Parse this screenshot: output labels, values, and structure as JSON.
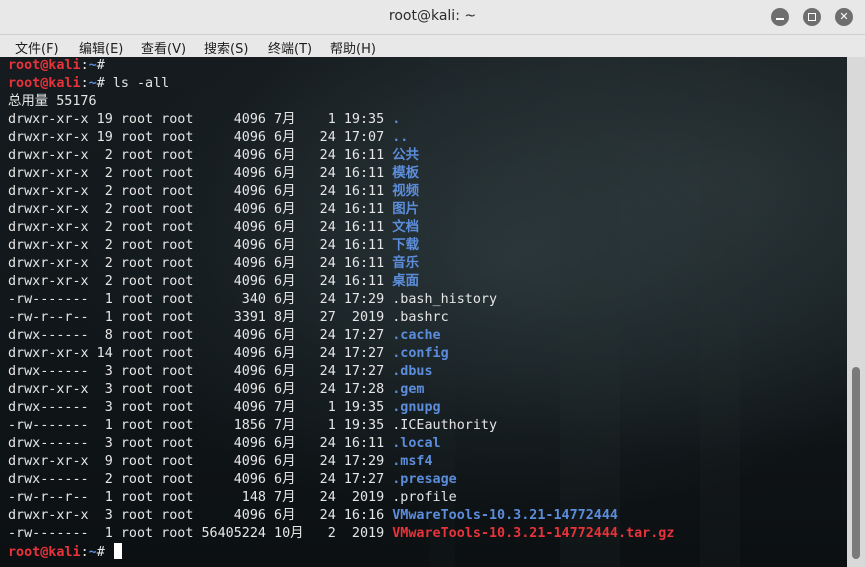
{
  "window": {
    "title": "root@kali: ~"
  },
  "menu": [
    "文件(F)",
    "编辑(E)",
    "查看(V)",
    "搜索(S)",
    "终端(T)",
    "帮助(H)"
  ],
  "prompt": {
    "user": "root@kali",
    "sep": ":",
    "path": "~",
    "symbol": "#"
  },
  "command": " ls -all",
  "total_line": "总用量 55176",
  "entries": [
    {
      "meta": "drwxr-xr-x 19 root root     4096 7月    1 19:35 ",
      "name": ".",
      "type": "dir"
    },
    {
      "meta": "drwxr-xr-x 19 root root     4096 6月   24 17:07 ",
      "name": "..",
      "type": "dir"
    },
    {
      "meta": "drwxr-xr-x  2 root root     4096 6月   24 16:11 ",
      "name": "公共",
      "type": "dir"
    },
    {
      "meta": "drwxr-xr-x  2 root root     4096 6月   24 16:11 ",
      "name": "模板",
      "type": "dir"
    },
    {
      "meta": "drwxr-xr-x  2 root root     4096 6月   24 16:11 ",
      "name": "视频",
      "type": "dir"
    },
    {
      "meta": "drwxr-xr-x  2 root root     4096 6月   24 16:11 ",
      "name": "图片",
      "type": "dir"
    },
    {
      "meta": "drwxr-xr-x  2 root root     4096 6月   24 16:11 ",
      "name": "文档",
      "type": "dir"
    },
    {
      "meta": "drwxr-xr-x  2 root root     4096 6月   24 16:11 ",
      "name": "下载",
      "type": "dir"
    },
    {
      "meta": "drwxr-xr-x  2 root root     4096 6月   24 16:11 ",
      "name": "音乐",
      "type": "dir"
    },
    {
      "meta": "drwxr-xr-x  2 root root     4096 6月   24 16:11 ",
      "name": "桌面",
      "type": "dir"
    },
    {
      "meta": "-rw-------  1 root root      340 6月   24 17:29 ",
      "name": ".bash_history",
      "type": "file"
    },
    {
      "meta": "-rw-r--r--  1 root root     3391 8月   27  2019 ",
      "name": ".bashrc",
      "type": "file"
    },
    {
      "meta": "drwx------  8 root root     4096 6月   24 17:27 ",
      "name": ".cache",
      "type": "dir"
    },
    {
      "meta": "drwxr-xr-x 14 root root     4096 6月   24 17:27 ",
      "name": ".config",
      "type": "dir"
    },
    {
      "meta": "drwx------  3 root root     4096 6月   24 17:27 ",
      "name": ".dbus",
      "type": "dir"
    },
    {
      "meta": "drwxr-xr-x  3 root root     4096 6月   24 17:28 ",
      "name": ".gem",
      "type": "dir"
    },
    {
      "meta": "drwx------  3 root root     4096 7月    1 19:35 ",
      "name": ".gnupg",
      "type": "dir"
    },
    {
      "meta": "-rw-------  1 root root     1856 7月    1 19:35 ",
      "name": ".ICEauthority",
      "type": "file"
    },
    {
      "meta": "drwx------  3 root root     4096 6月   24 16:11 ",
      "name": ".local",
      "type": "dir"
    },
    {
      "meta": "drwxr-xr-x  9 root root     4096 6月   24 17:29 ",
      "name": ".msf4",
      "type": "dir"
    },
    {
      "meta": "drwx------  2 root root     4096 6月   24 17:27 ",
      "name": ".presage",
      "type": "dir"
    },
    {
      "meta": "-rw-r--r--  1 root root      148 7月   24  2019 ",
      "name": ".profile",
      "type": "file"
    },
    {
      "meta": "drwxr-xr-x  3 root root     4096 6月   24 16:16 ",
      "name": "VMwareTools-10.3.21-14772444",
      "type": "dir"
    },
    {
      "meta": "-rw-------  1 root root 56405224 10月   2  2019 ",
      "name": "VMwareTools-10.3.21-14772444.tar.gz",
      "type": "archive"
    }
  ],
  "icons": {
    "minimize": "minimize-icon",
    "maximize": "maximize-icon",
    "close": "close-icon"
  },
  "colors": {
    "prompt_user": "#e8333a",
    "prompt_path": "#5c8ddb",
    "directory": "#5c8ddb",
    "archive": "#e8333a"
  }
}
